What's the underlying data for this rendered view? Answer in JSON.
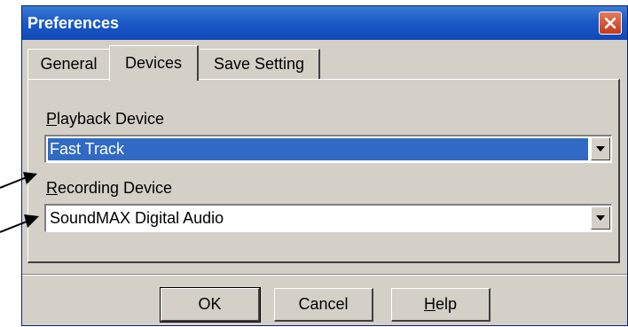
{
  "window": {
    "title": "Preferences",
    "close_icon": "close-icon",
    "accent_color": "#1c5bc8",
    "close_color": "#d0482a"
  },
  "tabs": [
    {
      "label": "General",
      "active": false
    },
    {
      "label": "Devices",
      "active": true
    },
    {
      "label": "Save Setting",
      "active": false
    }
  ],
  "playback": {
    "label_prefix": "",
    "label_mnemonic": "P",
    "label_rest": "layback Device",
    "value": "Fast Track",
    "selected": true
  },
  "recording": {
    "label_mnemonic": "R",
    "label_rest": "ecording Device",
    "value": "SoundMAX Digital Audio",
    "selected": false
  },
  "buttons": {
    "ok": "OK",
    "cancel": "Cancel",
    "help_mnemonic": "H",
    "help_rest": "elp"
  },
  "selection_color": "#316ac5",
  "annotation_arrows": [
    "arrow-to-recording-label",
    "arrow-to-recording-combo"
  ]
}
